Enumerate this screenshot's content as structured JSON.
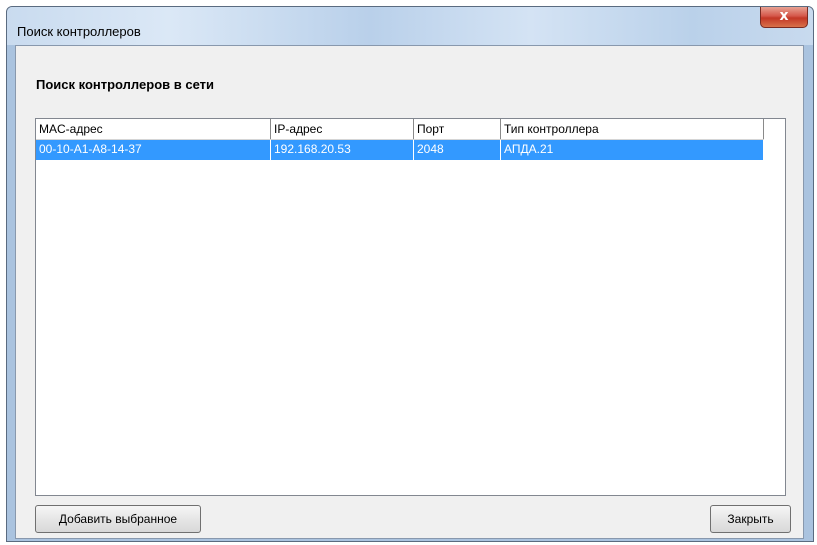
{
  "window": {
    "title": "Поиск контроллеров",
    "close_glyph": "x"
  },
  "dialog": {
    "section_title": "Поиск контроллеров в сети"
  },
  "table": {
    "columns": [
      "MAC-адрес",
      "IP-адрес",
      "Порт",
      "Тип контроллера"
    ],
    "rows": [
      {
        "mac": "00-10-A1-A8-14-37",
        "ip": "192.168.20.53",
        "port": "2048",
        "type": "АПДА.21",
        "selected": true
      }
    ]
  },
  "buttons": {
    "add_selected": "Добавить выбранное",
    "close": "Закрыть"
  },
  "colors": {
    "selection": "#3399ff",
    "title_bar": "#c9dbef",
    "close_button": "#c33726"
  }
}
